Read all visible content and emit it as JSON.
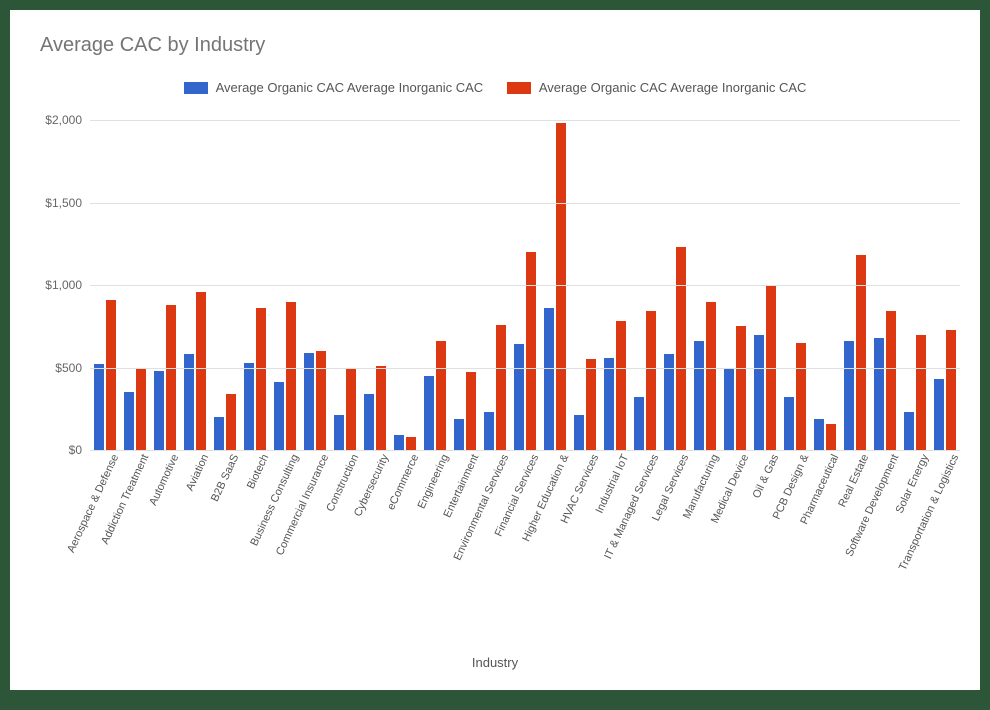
{
  "chart_data": {
    "type": "bar",
    "title": "Average CAC by Industry",
    "xlabel": "Industry",
    "ylabel": "",
    "ylim": [
      0,
      2000
    ],
    "yticks": [
      0,
      500,
      1000,
      1500,
      2000
    ],
    "ytick_labels": [
      "$0",
      "$500",
      "$1,000",
      "$1,500",
      "$2,000"
    ],
    "colors": {
      "series1": "#3366cc",
      "series2": "#dc3912"
    },
    "legend_position": "top",
    "categories": [
      "Aerospace & Defense",
      "Addiction Treatment",
      "Automotive",
      "Aviation",
      "B2B SaaS",
      "Biotech",
      "Business Consulting",
      "Commercial Insurance",
      "Construction",
      "Cybersecurity",
      "eCommerce",
      "Engineering",
      "Entertainment",
      "Environmental Services",
      "Financial Services",
      "Higher Education &",
      "HVAC Services",
      "Industrial IoT",
      "IT & Managed Services",
      "Legal Services",
      "Manufacturing",
      "Medical Device",
      "Oil & Gas",
      "PCB Design &",
      "Pharmaceutical",
      "Real Estate",
      "Software Development",
      "Solar Energy",
      "Transportation & Logistics"
    ],
    "series": [
      {
        "name": "Average Organic CAC Average Inorganic CAC",
        "values": [
          520,
          350,
          480,
          580,
          200,
          530,
          410,
          590,
          210,
          340,
          90,
          450,
          190,
          230,
          640,
          860,
          210,
          560,
          320,
          580,
          660,
          500,
          700,
          320,
          190,
          660,
          680,
          230,
          430
        ]
      },
      {
        "name": "Average Organic CAC Average Inorganic CAC",
        "values": [
          910,
          500,
          880,
          960,
          340,
          860,
          900,
          600,
          490,
          510,
          80,
          660,
          470,
          760,
          1200,
          1980,
          550,
          780,
          840,
          1230,
          900,
          750,
          1000,
          650,
          160,
          1180,
          840,
          700,
          730
        ]
      }
    ]
  }
}
